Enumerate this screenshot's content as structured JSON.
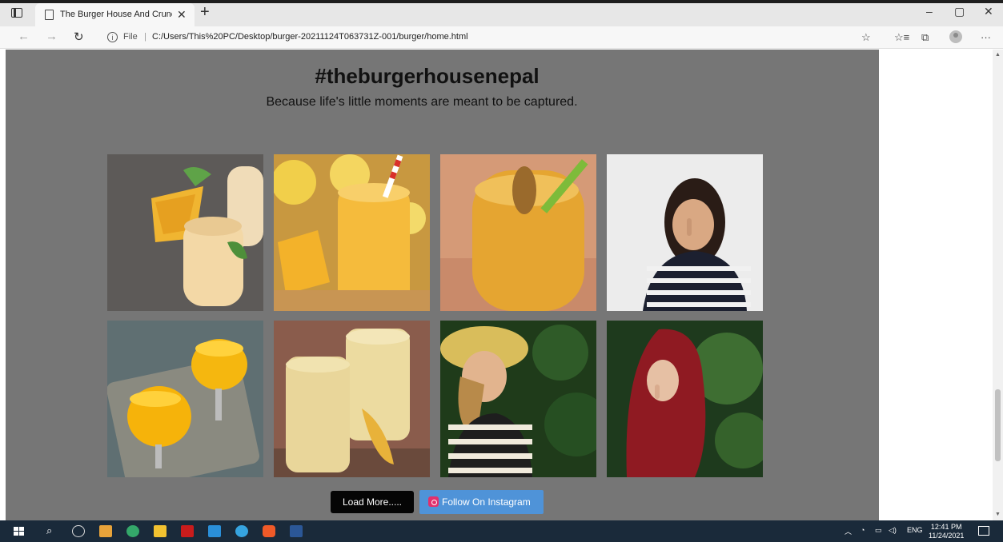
{
  "browser": {
    "tab_title": "The Burger House And Crunchy",
    "tab_close": "✕",
    "new_tab": "+",
    "file_label": "File",
    "url": "C:/Users/This%20PC/Desktop/burger-20211124T063731Z-001/burger/home.html",
    "window_controls": {
      "minimize": "–",
      "restore": "▢",
      "close": "✕"
    }
  },
  "page": {
    "hashtag": "#theburgerhousenepal",
    "tagline": "Because life's little moments are meant to be captured.",
    "gallery": [
      {
        "subject": "mango smoothie with mango cubes"
      },
      {
        "subject": "mango smoothie with striped straw and lemons"
      },
      {
        "subject": "mango smoothie with green straw"
      },
      {
        "subject": "girl in striped shirt with finger on lips"
      },
      {
        "subject": "mango pudding glasses on tray"
      },
      {
        "subject": "two glasses of mango lassi"
      },
      {
        "subject": "woman in yellow hat and striped dress"
      },
      {
        "subject": "woman in red hood with finger on lips"
      }
    ],
    "load_more_label": "Load More.....",
    "instagram_label": "Follow On Instagram"
  },
  "taskbar": {
    "tray_language": "ENG",
    "clock_time": "12:41 PM",
    "clock_date": "11/24/2021"
  },
  "colors": {
    "page_overlay": "#767676",
    "instagram_button": "#4f93d8",
    "load_more_button": "#050505"
  }
}
